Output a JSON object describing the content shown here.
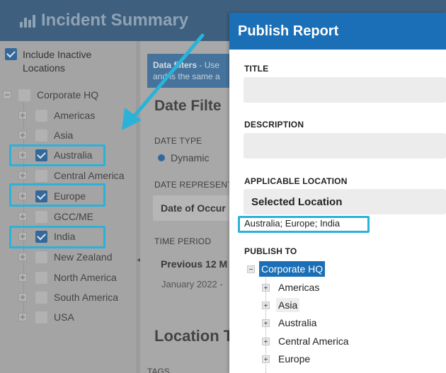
{
  "app": {
    "title": "Incident Summary",
    "include_inactive_label": "Include Inactive Locations",
    "location_tree": {
      "root": "Corporate HQ",
      "items": [
        {
          "label": "Americas",
          "checked": false
        },
        {
          "label": "Asia",
          "checked": false
        },
        {
          "label": "Australia",
          "checked": true
        },
        {
          "label": "Central America",
          "checked": false
        },
        {
          "label": "Europe",
          "checked": true
        },
        {
          "label": "GCC/ME",
          "checked": false
        },
        {
          "label": "India",
          "checked": true
        },
        {
          "label": "New Zealand",
          "checked": false
        },
        {
          "label": "North America",
          "checked": false
        },
        {
          "label": "South America",
          "checked": false
        },
        {
          "label": "USA",
          "checked": false
        }
      ]
    },
    "filters_banner": {
      "bold": "Data filters",
      "rest": " - Use",
      "line2": "and is the same a"
    },
    "date_filters_heading": "Date Filte",
    "date_type_label": "DATE TYPE",
    "date_type_value": "Dynamic",
    "date_represents_label": "DATE REPRESENT",
    "date_represents_value": "Date of Occur",
    "time_period_label": "TIME PERIOD",
    "time_period_value": "Previous 12 M",
    "time_period_note": "January 2022 -",
    "location_heading": "Location T",
    "tags_label": "TAGS"
  },
  "modal": {
    "title": "Publish Report",
    "title_label": "TITLE",
    "description_label": "DESCRIPTION",
    "applicable_location_label": "APPLICABLE LOCATION",
    "applicable_location_value": "Selected Location",
    "selected_locations_text": "Australia; Europe; India",
    "publish_to_label": "PUBLISH TO",
    "publish_tree": {
      "root": "Corporate HQ",
      "items": [
        "Americas",
        "Asia",
        "Australia",
        "Central America",
        "Europe"
      ]
    }
  },
  "colors": {
    "highlight": "#2bb2d9",
    "modal_header": "#1a6fb6",
    "checkbox_checked": "#33699a"
  }
}
